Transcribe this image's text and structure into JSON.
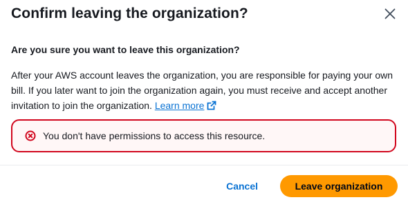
{
  "modal": {
    "title": "Confirm leaving the organization?",
    "close_icon": "close-icon"
  },
  "body": {
    "question": "Are you sure you want to leave this organization?",
    "description": "After your AWS account leaves the organization, you are responsible for paying your own bill. If you later want to join the organization again, you must receive and accept another invitation to join the organization.",
    "learn_more_label": "Learn more",
    "learn_more_icon": "external-link-icon"
  },
  "alert": {
    "type": "error",
    "icon": "error-icon",
    "message": "You don't have permissions to access this resource.",
    "border_color": "#d1051c",
    "background_color": "#fff7f7"
  },
  "footer": {
    "cancel_label": "Cancel",
    "primary_label": "Leave organization",
    "primary_color": "#ff9900",
    "link_color": "#0972d3"
  }
}
